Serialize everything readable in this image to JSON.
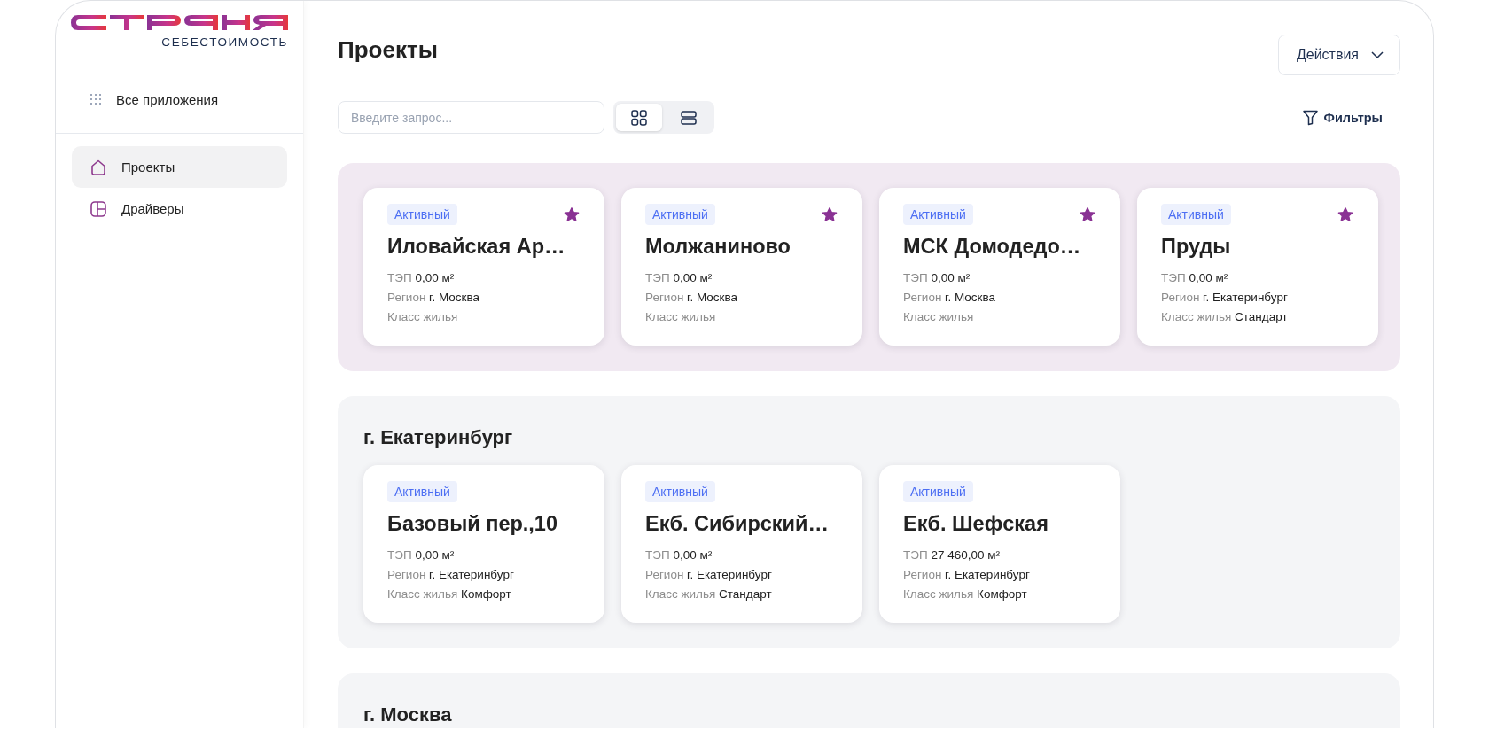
{
  "sidebar": {
    "brand_subtitle": "СЕБЕСТОИМОСТЬ",
    "apps_link": "Все приложения",
    "items": [
      {
        "label": "Проекты",
        "kind": "home",
        "selected": true
      },
      {
        "label": "Драйверы",
        "kind": "layout",
        "selected": false
      }
    ]
  },
  "header": {
    "title": "Проекты",
    "actions_button": "Действия"
  },
  "toolbar": {
    "search": {
      "placeholder": "Введите запрос..."
    },
    "view_modes": [
      {
        "kind": "grid",
        "selected": true
      },
      {
        "kind": "list",
        "selected": false
      }
    ],
    "filters_button": "Фильтры"
  },
  "sections": [
    {
      "kind": "favorites",
      "projects": [
        {
          "status": "Активный",
          "favorite": true,
          "name": "Иловайская Ар…",
          "fields": [
            {
              "label": "ТЭП",
              "value": "0,00 м²"
            },
            {
              "label": "Регион",
              "value": "г. Москва"
            },
            {
              "label": "Класс жилья"
            }
          ]
        },
        {
          "status": "Активный",
          "favorite": true,
          "name": "Молжаниново",
          "fields": [
            {
              "label": "ТЭП",
              "value": "0,00 м²"
            },
            {
              "label": "Регион",
              "value": "г. Москва"
            },
            {
              "label": "Класс жилья"
            }
          ]
        },
        {
          "status": "Активный",
          "favorite": true,
          "name": "МСК Домодедо…",
          "fields": [
            {
              "label": "ТЭП",
              "value": "0,00 м²"
            },
            {
              "label": "Регион",
              "value": "г. Москва"
            },
            {
              "label": "Класс жилья"
            }
          ]
        },
        {
          "status": "Активный",
          "favorite": true,
          "name": "Пруды",
          "fields": [
            {
              "label": "ТЭП",
              "value": "0,00 м²"
            },
            {
              "label": "Регион",
              "value": "г. Екатеринбург"
            },
            {
              "label": "Класс жилья",
              "value": "Стандарт"
            }
          ]
        }
      ]
    },
    {
      "kind": "group",
      "title": "г. Екатеринбург",
      "projects": [
        {
          "status": "Активный",
          "favorite": false,
          "name": "Базовый пер.,10",
          "fields": [
            {
              "label": "ТЭП",
              "value": "0,00 м²"
            },
            {
              "label": "Регион",
              "value": "г. Екатеринбург"
            },
            {
              "label": "Класс жилья",
              "value": "Комфорт"
            }
          ]
        },
        {
          "status": "Активный",
          "favorite": false,
          "name": "Екб. Сибирский…",
          "fields": [
            {
              "label": "ТЭП",
              "value": "0,00 м²"
            },
            {
              "label": "Регион",
              "value": "г. Екатеринбург"
            },
            {
              "label": "Класс жилья",
              "value": "Стандарт"
            }
          ]
        },
        {
          "status": "Активный",
          "favorite": false,
          "name": "Екб. Шефская",
          "fields": [
            {
              "label": "ТЭП",
              "value": "27 460,00 м²"
            },
            {
              "label": "Регион",
              "value": "г. Екатеринбург"
            },
            {
              "label": "Класс жилья",
              "value": "Комфорт"
            }
          ]
        }
      ]
    },
    {
      "kind": "group",
      "title": "г. Москва"
    }
  ]
}
